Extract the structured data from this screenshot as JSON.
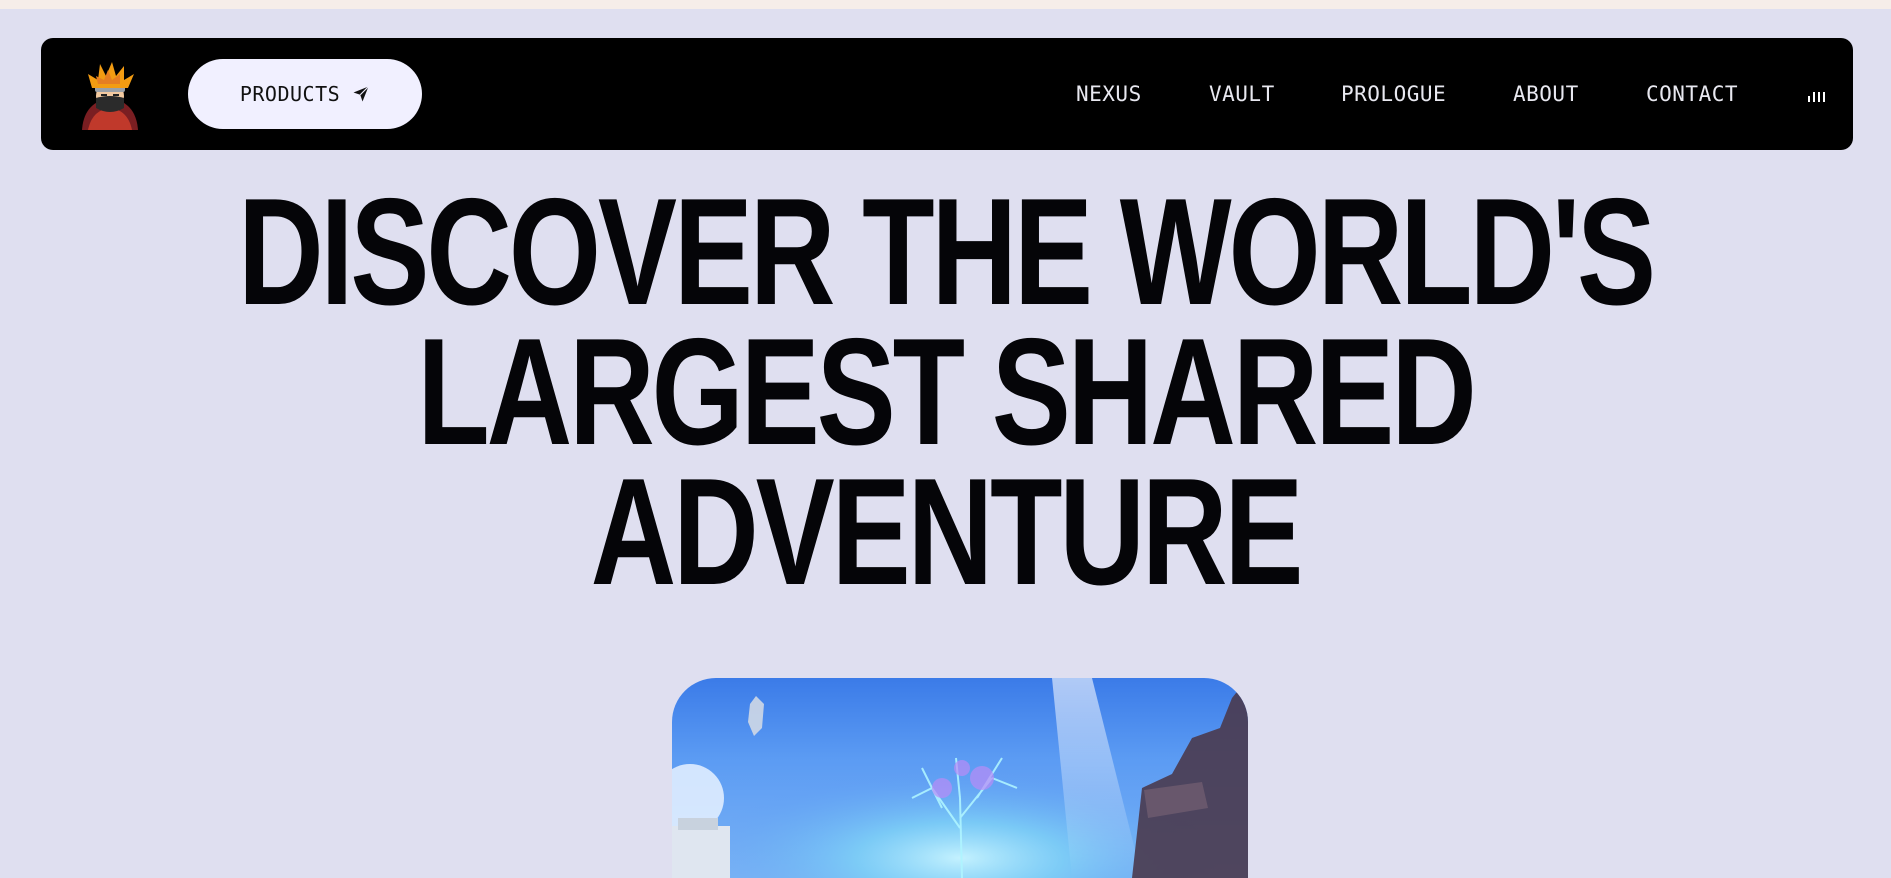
{
  "nav": {
    "products_label": "PRODUCTS",
    "links": [
      "NEXUS",
      "VAULT",
      "PROLOGUE",
      "ABOUT",
      "CONTACT"
    ]
  },
  "hero": {
    "lines": [
      "DISCOVER THE WORLD'S",
      "LARGEST SHARED",
      "ADVENTURE"
    ]
  },
  "colors": {
    "page_bg": "#dfdff0",
    "navbar_bg": "#000000",
    "button_bg": "#f1f0ff",
    "title": "#050508"
  },
  "icons": {
    "logo": "ninja-avatar-logo",
    "products": "send-arrow-icon",
    "audio": "audio-bars-icon"
  }
}
